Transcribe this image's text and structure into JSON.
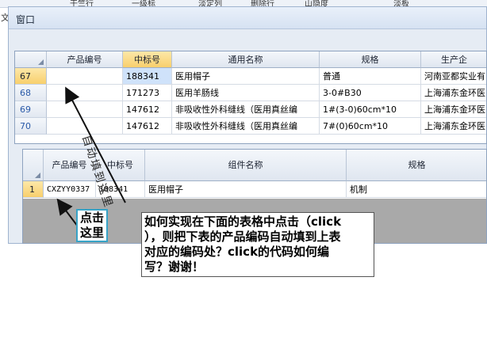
{
  "host": {
    "left_char": "文",
    "toolbar_fragments": [
      "干竺行",
      "一级标",
      "淡定列",
      "删除行",
      "山隐度",
      "淡板"
    ]
  },
  "window": {
    "title": "窗口"
  },
  "upper_grid": {
    "columns": [
      "产品编号",
      "中标号",
      "通用名称",
      "规格",
      "生产企"
    ],
    "active_column": "中标号",
    "rows": [
      {
        "num": "67",
        "product_code": "",
        "bid_no": "188341",
        "name": "医用帽子",
        "spec": "普通",
        "maker": "河南亚都实业有"
      },
      {
        "num": "68",
        "product_code": "",
        "bid_no": "171273",
        "name": "医用羊肠线",
        "spec": "3-0#B30",
        "maker": "上海浦东金环医"
      },
      {
        "num": "69",
        "product_code": "",
        "bid_no": "147612",
        "name": "非吸收性外科缝线（医用真丝编",
        "spec": "1#(3-0)60cm*10",
        "maker": "上海浦东金环医"
      },
      {
        "num": "70",
        "product_code": "",
        "bid_no": "147612",
        "name": "非吸收性外科缝线（医用真丝编",
        "spec": "7#(0)60cm*10",
        "maker": "上海浦东金环医"
      }
    ]
  },
  "lower_grid": {
    "columns": [
      "产品编号",
      "中标号",
      "组件名称",
      "规格"
    ],
    "rows": [
      {
        "num": "1",
        "product_code": "CXZYY0337",
        "bid_no": "188341",
        "component": "医用帽子",
        "spec": "机制"
      }
    ]
  },
  "annotations": {
    "vertical_label": "自动填到这里",
    "click_label_line1": "点击",
    "click_label_line2": "这里",
    "question_lines": [
      "如何实现在下面的表格中点击（click",
      "），则把下表的产品编码自动填到上表",
      "对应的编码处？click的代码如何编",
      "写？谢谢！"
    ]
  }
}
